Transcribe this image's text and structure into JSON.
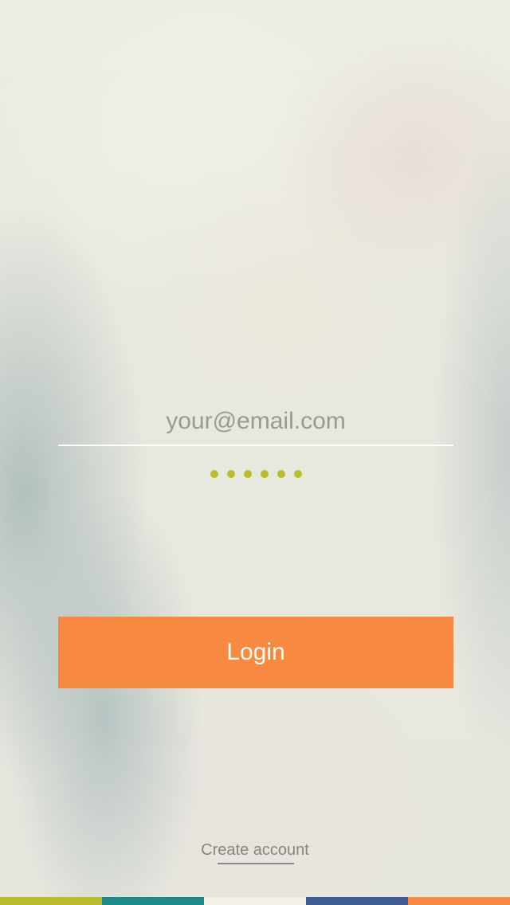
{
  "login": {
    "email_placeholder": "your@email.com",
    "email_value": "",
    "password_masked_length": 6,
    "button_label": "Login"
  },
  "footer": {
    "create_account_label": "Create account"
  },
  "colors": {
    "accent": "#f78a40",
    "password_dot": "#b9bd2a",
    "input_underline": "#ffffff"
  },
  "color_strip": [
    "#b9bd2a",
    "#1d8a8a",
    "#f2f0e8",
    "#3f5b93",
    "#f78a40"
  ]
}
